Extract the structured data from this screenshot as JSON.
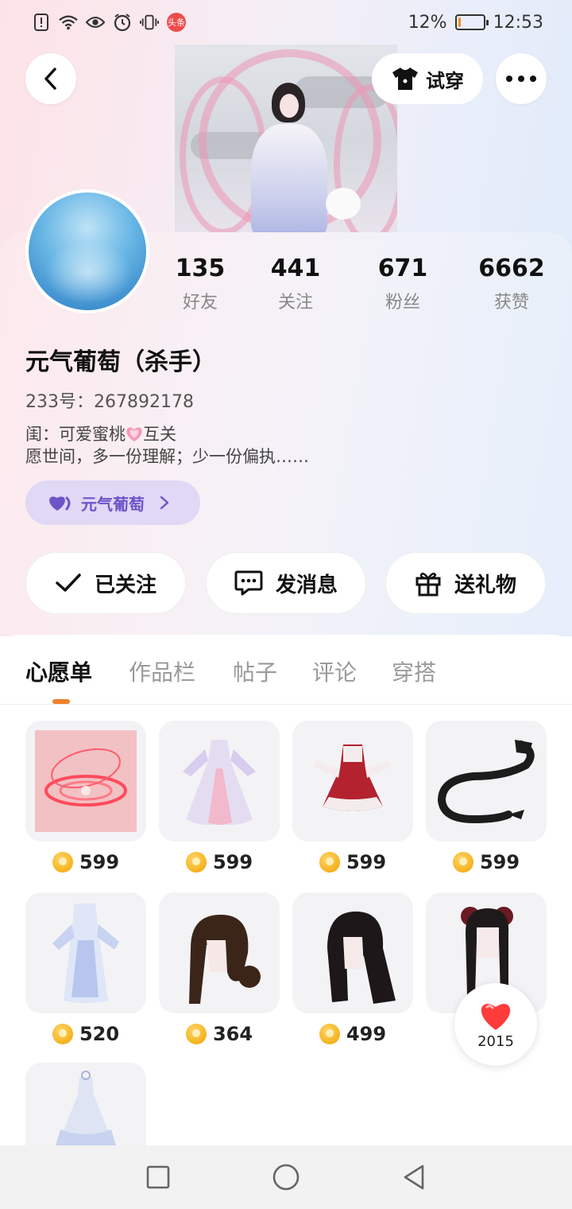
{
  "status_bar": {
    "time": "12:53",
    "battery_percent": "12%",
    "battery_level": 0.12,
    "badge_text": "头条"
  },
  "header": {
    "try_on_label": "试穿"
  },
  "profile": {
    "stats": [
      {
        "value": "135",
        "label": "好友"
      },
      {
        "value": "441",
        "label": "关注"
      },
      {
        "value": "671",
        "label": "粉丝"
      },
      {
        "value": "6662",
        "label": "获赞"
      }
    ],
    "name": "元气葡萄（杀手）",
    "uid_label": "233号：267892178",
    "bio_line1_a": "闺：可爱蜜桃",
    "bio_line1_b": "互关",
    "bio_line2": "愿世间，多一份理解；少一份偏执……",
    "tag_label": "元气葡萄"
  },
  "actions": {
    "follow_label": "已关注",
    "message_label": "发消息",
    "gift_label": "送礼物"
  },
  "tabs": [
    {
      "label": "心愿单",
      "active": true
    },
    {
      "label": "作品栏",
      "active": false
    },
    {
      "label": "帖子",
      "active": false
    },
    {
      "label": "评论",
      "active": false
    },
    {
      "label": "穿搭",
      "active": false
    }
  ],
  "wishlist": [
    {
      "price": "599",
      "icon": "glow-ring-platform"
    },
    {
      "price": "599",
      "icon": "lavender-dress"
    },
    {
      "price": "599",
      "icon": "red-white-dress"
    },
    {
      "price": "599",
      "icon": "black-dragon"
    },
    {
      "price": "520",
      "icon": "white-blue-gown"
    },
    {
      "price": "364",
      "icon": "brown-hair-bun"
    },
    {
      "price": "499",
      "icon": "black-long-hair"
    },
    {
      "price": "",
      "icon": "black-twin-tails"
    },
    {
      "price": "",
      "icon": "white-wedding-dress"
    }
  ],
  "like_fab": {
    "count": "2015"
  },
  "colors": {
    "accent_orange": "#f0812a",
    "tag_purple": "#6b56c8",
    "coin_gold": "#f5b21c"
  }
}
